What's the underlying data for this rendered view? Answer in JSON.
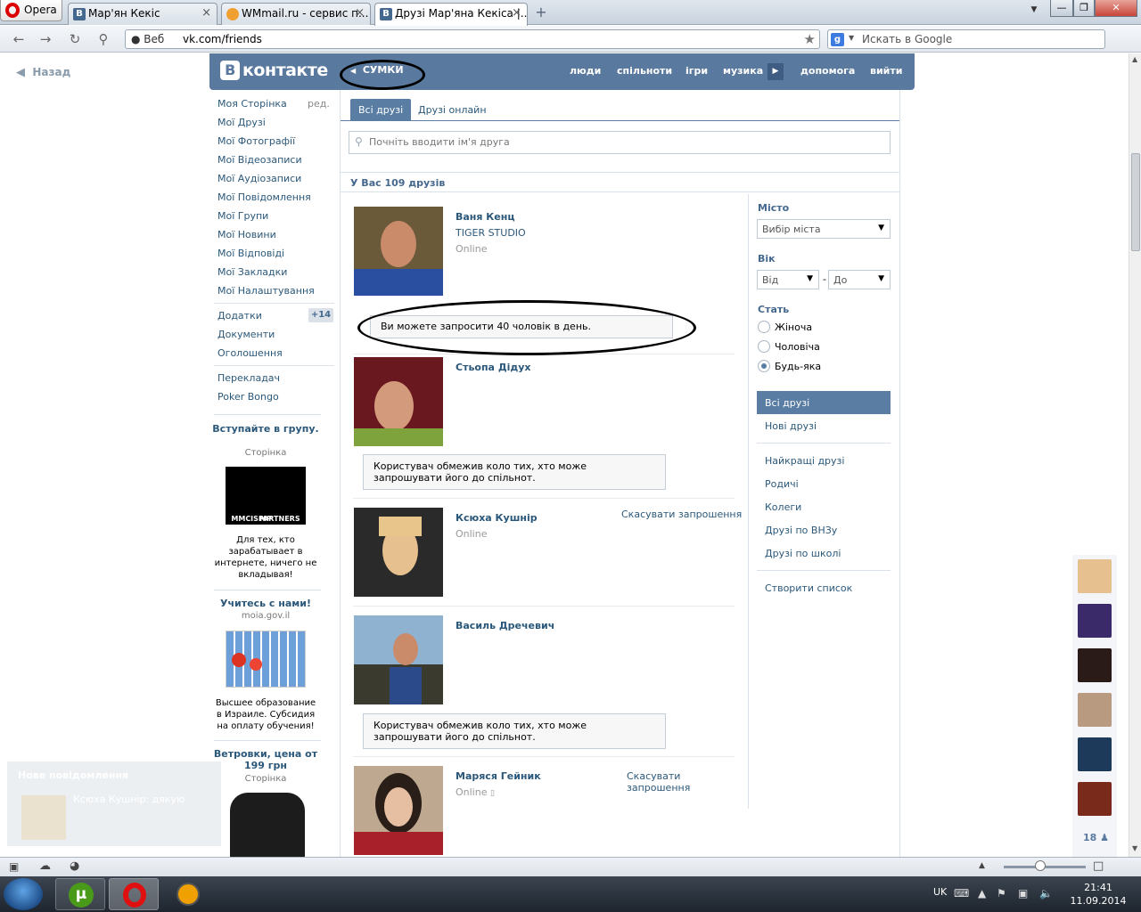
{
  "browser": {
    "menu_label": "Opera",
    "tabs": [
      {
        "label": "Мар'ян Кекіс"
      },
      {
        "label": "WMmail.ru - сервис п..."
      },
      {
        "label": "Друзі Мар'яна Кекіса |..."
      }
    ],
    "web_label": "Веб",
    "url": "vk.com/friends",
    "search_engine": "g",
    "search_placeholder": "Искать в Google",
    "window_controls": [
      "▼",
      "—",
      "❐",
      "✕"
    ]
  },
  "page": {
    "back_label": "Назад",
    "logo_letter": "В",
    "logo_text": "контакте",
    "groups_label": "СУМКИ",
    "top_nav": [
      "люди",
      "спільноти",
      "ігри",
      "музика",
      "допомога",
      "вийти"
    ],
    "left_menu": [
      "Моя Сторінка",
      "Мої Друзі",
      "Мої Фотографії",
      "Мої Відеозаписи",
      "Мої Аудіозаписи",
      "Мої Повідомлення",
      "Мої Групи",
      "Мої Новини",
      "Мої Відповіді",
      "Мої Закладки",
      "Мої Налаштування"
    ],
    "edit_label": "ред.",
    "left_menu_extra": [
      "Додатки",
      "Документи",
      "Оголошення"
    ],
    "apps_badge": "+14",
    "left_menu_links": [
      "Перекладач",
      "Poker Bongo"
    ],
    "ads": [
      {
        "title": "Вступайте в групу.",
        "sub": "Сторінка",
        "logo": "MP",
        "logo_caption": "MMCISPARTNERS",
        "text": "Для тех, кто зарабатывает в интернете, ничего не вкладывая!"
      },
      {
        "title": "Учитесь с нами!",
        "sub": "moia.gov.il",
        "text": "Высшее образование в Израиле. Субсидия на оплату обучения!"
      },
      {
        "title": "Ветровки, цена от 199 грн",
        "sub": "Сторінка"
      }
    ],
    "notification": {
      "title": "Нове повідомлення",
      "text": "Ксюха Кушнір: дякую"
    }
  },
  "friends": {
    "tabs": [
      {
        "label": "Всі друзі"
      },
      {
        "label": "Друзі онлайн"
      }
    ],
    "search_placeholder": "Почніть вводити ім'я друга",
    "count_label": "У Вас 109 друзів",
    "list": [
      {
        "name": "Ваня Кенц",
        "sub": "TIGER STUDIO",
        "status": "Online",
        "avatar_colors": [
          "#6b5a3a",
          "#2a4ea0"
        ]
      },
      {
        "name": "Стьопа Дідух",
        "status": "",
        "avatar_colors": [
          "#6a1820",
          "#7ea33c"
        ]
      },
      {
        "name": "Ксюха Кушнір",
        "status": "Online",
        "action": "Скасувати запрошення",
        "avatar_colors": [
          "#2a2a2a",
          "#e6c18f"
        ]
      },
      {
        "name": "Василь Дречевич",
        "status": "",
        "avatar_colors": [
          "#8fb2d0",
          "#3a3a2e"
        ]
      },
      {
        "name": "Маряся Гейник",
        "status": "Online",
        "action": "Скасувати запрошення",
        "avatar_colors": [
          "#bfa890",
          "#a8202a"
        ]
      }
    ],
    "invite_notice": "Ви можете запросити 40 чоловік в день.",
    "restricted_notice": "Користувач обмежив коло тих, хто може запрошувати його до спільнот."
  },
  "filter": {
    "city_label": "Місто",
    "city_value": "Вибір міста",
    "age_label": "Вік",
    "age_from": "Від",
    "age_dash": "-",
    "age_to": "До",
    "gender_label": "Стать",
    "genders": [
      "Жіноча",
      "Чоловіча",
      "Будь-яка"
    ],
    "selected_gender": 2,
    "lists": [
      "Всі друзі",
      "Нові друзі"
    ],
    "lists2": [
      "Найкращі друзі",
      "Родичі",
      "Колеги",
      "Друзі по ВНЗу",
      "Друзі по школі"
    ],
    "create_list": "Створити список"
  },
  "online_strip": {
    "count": "18",
    "avatar_colors": [
      "#e6c18f",
      "#3a2a6a",
      "#2a1a18",
      "#b89a80",
      "#1e3a5a",
      "#7a2a1a"
    ]
  },
  "taskbar": {
    "lang": "UK",
    "time": "21:41",
    "date": "11.09.2014"
  }
}
